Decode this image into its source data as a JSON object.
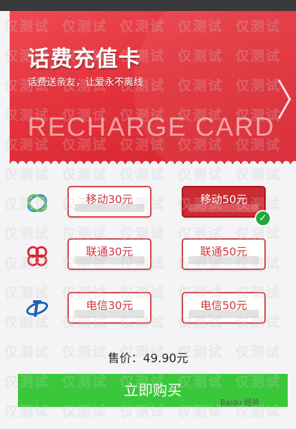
{
  "banner": {
    "title": "话费充值卡",
    "subtitle": "话费送亲友，让爱永不离线",
    "english": "RECHARGE CARD"
  },
  "carriers": [
    {
      "name": "china-mobile",
      "icon": "china-mobile-logo",
      "options": [
        "移动30元",
        "移动50元"
      ],
      "selected_index": 1
    },
    {
      "name": "china-unicom",
      "icon": "china-unicom-logo",
      "options": [
        "联通30元",
        "联通50元"
      ],
      "selected_index": null
    },
    {
      "name": "china-telecom",
      "icon": "china-telecom-logo",
      "options": [
        "电信30元",
        "电信50元"
      ],
      "selected_index": null
    }
  ],
  "price": {
    "text": "售价：49.90元"
  },
  "buy_button": {
    "label": "立即购买"
  },
  "watermark": {
    "text": "仅测试"
  },
  "footer": {
    "text": "Baidu 经验"
  },
  "colors": {
    "accent": "#d0343c",
    "buy": "#3ac83a",
    "check": "#23a93a"
  }
}
